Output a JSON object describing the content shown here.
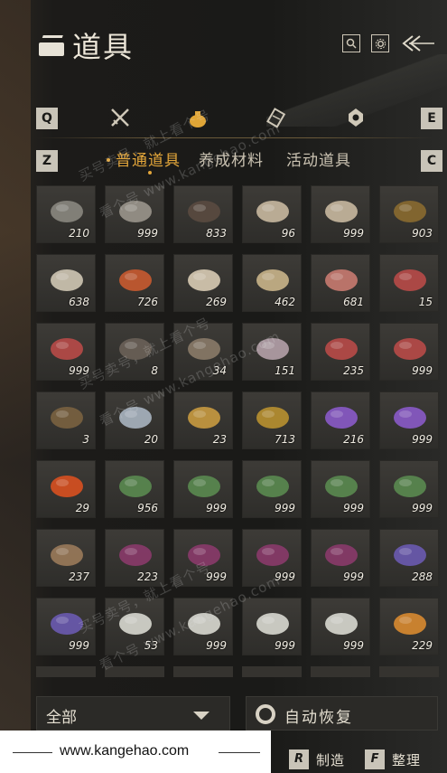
{
  "header": {
    "title": "道具",
    "icons": [
      "search-icon",
      "settings-icon",
      "back-arrow-icon"
    ]
  },
  "tabs": {
    "left_key": "Q",
    "right_key": "E",
    "categories": [
      {
        "icon": "crossed-swords-icon",
        "active": false
      },
      {
        "icon": "bag-icon",
        "active": true
      },
      {
        "icon": "scroll-icon",
        "active": false
      },
      {
        "icon": "gem-icon",
        "active": false
      }
    ]
  },
  "subtabs": {
    "left_key": "Z",
    "right_key": "C",
    "items": [
      "普通道具",
      "养成材料",
      "活动道具"
    ],
    "active_index": 0
  },
  "items": [
    {
      "name": "stone-ore",
      "qty": "210",
      "color": "#8a8780"
    },
    {
      "name": "stone-ore",
      "qty": "999",
      "color": "#9a958c"
    },
    {
      "name": "feather",
      "qty": "833",
      "color": "#5a4a40"
    },
    {
      "name": "mushrooms",
      "qty": "96",
      "color": "#c8b8a0"
    },
    {
      "name": "mushrooms",
      "qty": "999",
      "color": "#c8b8a0"
    },
    {
      "name": "cricket",
      "qty": "903",
      "color": "#8a6a30"
    },
    {
      "name": "grain-sack",
      "qty": "638",
      "color": "#cfc6b4"
    },
    {
      "name": "berries",
      "qty": "726",
      "color": "#c85a30"
    },
    {
      "name": "mushroom-cluster",
      "qty": "269",
      "color": "#d8cbb4"
    },
    {
      "name": "eggs",
      "qty": "462",
      "color": "#c9b48a"
    },
    {
      "name": "raw-meat",
      "qty": "681",
      "color": "#c87a70"
    },
    {
      "name": "steak",
      "qty": "15",
      "color": "#b84a48"
    },
    {
      "name": "steak",
      "qty": "999",
      "color": "#b84a48"
    },
    {
      "name": "feathers",
      "qty": "8",
      "color": "#6a6058"
    },
    {
      "name": "fur",
      "qty": "34",
      "color": "#8a7a68"
    },
    {
      "name": "intestines",
      "qty": "151",
      "color": "#b4a0a8"
    },
    {
      "name": "steak",
      "qty": "235",
      "color": "#b84a48"
    },
    {
      "name": "steak",
      "qty": "999",
      "color": "#b84a48"
    },
    {
      "name": "fish-dark",
      "qty": "3",
      "color": "#7a6240"
    },
    {
      "name": "fish-silver",
      "qty": "20",
      "color": "#a8b4c0"
    },
    {
      "name": "fish-golden",
      "qty": "23",
      "color": "#c89a40"
    },
    {
      "name": "gold-ore",
      "qty": "713",
      "color": "#b89030"
    },
    {
      "name": "amethyst",
      "qty": "216",
      "color": "#8a5ac8"
    },
    {
      "name": "amethyst",
      "qty": "999",
      "color": "#8a5ac8"
    },
    {
      "name": "red-orb",
      "qty": "29",
      "color": "#d85020"
    },
    {
      "name": "herb-white",
      "qty": "956",
      "color": "#5a8a50"
    },
    {
      "name": "herb-white",
      "qty": "999",
      "color": "#5a8a50"
    },
    {
      "name": "herb-white",
      "qty": "999",
      "color": "#5a8a50"
    },
    {
      "name": "herb-white",
      "qty": "999",
      "color": "#5a8a50"
    },
    {
      "name": "herb-white",
      "qty": "999",
      "color": "#5a8a50"
    },
    {
      "name": "seed-bowl",
      "qty": "237",
      "color": "#9a7a5a"
    },
    {
      "name": "purple-flower",
      "qty": "223",
      "color": "#8a3a6a"
    },
    {
      "name": "purple-flower",
      "qty": "999",
      "color": "#8a3a6a"
    },
    {
      "name": "purple-flower",
      "qty": "999",
      "color": "#8a3a6a"
    },
    {
      "name": "purple-flower",
      "qty": "999",
      "color": "#8a3a6a"
    },
    {
      "name": "lavender",
      "qty": "288",
      "color": "#6a5ab0"
    },
    {
      "name": "lavender",
      "qty": "999",
      "color": "#6a5ab0"
    },
    {
      "name": "white-flower",
      "qty": "53",
      "color": "#d8d8d0"
    },
    {
      "name": "white-flower",
      "qty": "999",
      "color": "#d8d8d0"
    },
    {
      "name": "white-flower",
      "qty": "999",
      "color": "#d8d8d0"
    },
    {
      "name": "white-flower",
      "qty": "999",
      "color": "#d8d8d0"
    },
    {
      "name": "orange-flower",
      "qty": "229",
      "color": "#d88a30"
    }
  ],
  "filter": {
    "label": "全部"
  },
  "auto_restore": {
    "label": "自动恢复"
  },
  "actions": [
    {
      "key": "R",
      "label": "制造"
    },
    {
      "key": "F",
      "label": "整理"
    }
  ],
  "watermark": {
    "url": "www.kangehao.com",
    "diagonal": [
      "买号卖号，就上看个号",
      "看个号 www.kangehao.com"
    ]
  }
}
